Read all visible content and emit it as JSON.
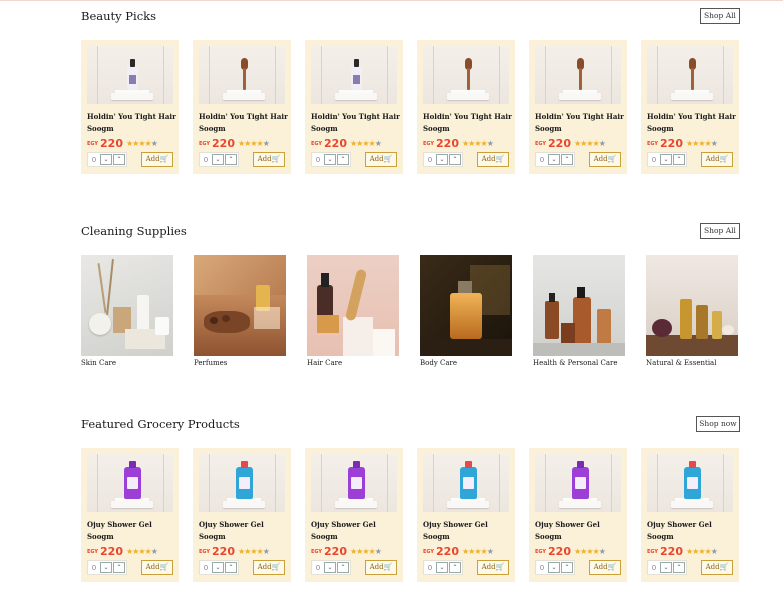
{
  "sections": {
    "beauty": {
      "title": "Beauty Picks",
      "shop_label": "Shop All",
      "products": [
        {
          "name": "Holdin' You Tight Hair Soogm",
          "currency": "EGY",
          "price": "220",
          "rating": 4,
          "image": "lotion-bottle"
        },
        {
          "name": "Holdin' You Tight Hair Soogm",
          "currency": "EGY",
          "price": "220",
          "rating": 4,
          "image": "wooden-brush"
        },
        {
          "name": "Holdin' You Tight Hair Soogm",
          "currency": "EGY",
          "price": "220",
          "rating": 4,
          "image": "lotion-bottle"
        },
        {
          "name": "Holdin' You Tight Hair Soogm",
          "currency": "EGY",
          "price": "220",
          "rating": 4,
          "image": "wooden-brush"
        },
        {
          "name": "Holdin' You Tight Hair Soogm",
          "currency": "EGY",
          "price": "220",
          "rating": 4,
          "image": "wooden-brush"
        },
        {
          "name": "Holdin' You Tight Hair Soogm",
          "currency": "EGY",
          "price": "220",
          "rating": 4,
          "image": "wooden-brush"
        }
      ]
    },
    "cleaning": {
      "title": "Cleaning Supplies",
      "shop_label": "Shop All",
      "categories": [
        {
          "name": "Skin Care"
        },
        {
          "name": "Perfumes"
        },
        {
          "name": "Hair Care"
        },
        {
          "name": "Body Care"
        },
        {
          "name": "Health & Personal Care"
        },
        {
          "name": "Natural & Essential"
        }
      ]
    },
    "grocery": {
      "title": "Featured Grocery Products",
      "shop_label": "Shop now",
      "products": [
        {
          "name": "Ojuy Shower Gel Soogm",
          "currency": "EGY",
          "price": "220",
          "rating": 4,
          "image": "purple-gel"
        },
        {
          "name": "Ojuy Shower Gel Soogm",
          "currency": "EGY",
          "price": "220",
          "rating": 4,
          "image": "blue-gel"
        },
        {
          "name": "Ojuy Shower Gel Soogm",
          "currency": "EGY",
          "price": "220",
          "rating": 4,
          "image": "purple-gel"
        },
        {
          "name": "Ojuy Shower Gel Soogm",
          "currency": "EGY",
          "price": "220",
          "rating": 4,
          "image": "blue-gel"
        },
        {
          "name": "Ojuy Shower Gel Soogm",
          "currency": "EGY",
          "price": "220",
          "rating": 4,
          "image": "purple-gel"
        },
        {
          "name": "Ojuy Shower Gel Soogm",
          "currency": "EGY",
          "price": "220",
          "rating": 4,
          "image": "blue-gel"
        }
      ]
    }
  },
  "common": {
    "qty_value": "0",
    "add_label": "Add",
    "rating_max": 5
  },
  "colors": {
    "card_bg": "#fbf1d9",
    "price": "#e8472b",
    "star": "#f2b01e",
    "add_border": "#c9a03a"
  }
}
